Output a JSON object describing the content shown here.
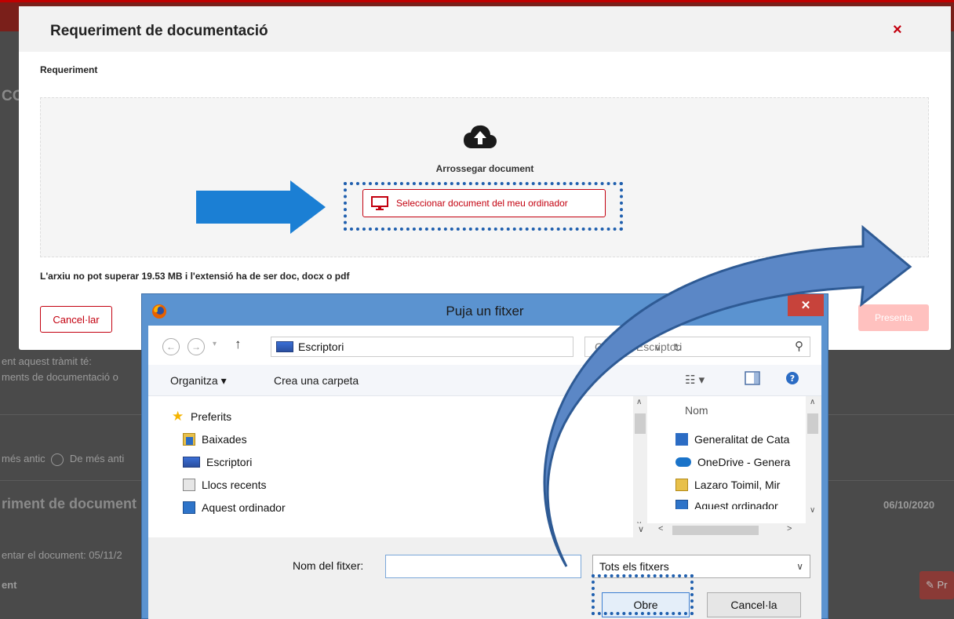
{
  "background": {
    "text_1": "ent aquest tràmit té:",
    "text_2": "ments de documentació o",
    "radio_text_1": "més antic",
    "radio_text_2": "De més anti",
    "item_title": "riment de document",
    "item_date": "06/10/2020",
    "deadline_text": "entar el document: 05/11/2",
    "doc_text": "ent",
    "side_button": "Pr",
    "left_fragment": "CO"
  },
  "modal": {
    "title": "Requeriment de documentació",
    "close": "×",
    "section_label": "Requeriment",
    "drag_label": "Arrossegar document",
    "select_button": "Seleccionar document del meu ordinador",
    "limit_text": "L'arxiu no pot superar 19.53 MB i l'extensió ha de ser doc, docx o pdf",
    "cancel_button": "Cancel·lar",
    "present_button": "Presenta"
  },
  "dialog": {
    "title": "Puja un fitxer",
    "close": "✕",
    "address": "Escriptori",
    "search_placeholder": "Cerca a Escriptori",
    "organize": "Organitza ▾",
    "new_folder": "Crea una carpeta",
    "tree": [
      {
        "label": "Preferits"
      },
      {
        "label": "Baixades"
      },
      {
        "label": "Escriptori"
      },
      {
        "label": "Llocs recents"
      },
      {
        "label": "Aquest ordinador"
      }
    ],
    "column_name": "Nom",
    "files": [
      {
        "label": "Generalitat de Cata"
      },
      {
        "label": "OneDrive - Genera"
      },
      {
        "label": "Lazaro Toimil, Mir"
      },
      {
        "label": "Aquest ordinador"
      }
    ],
    "filename_label": "Nom del fitxer:",
    "filename_value": "",
    "filetype": "Tots els fitxers",
    "open_button": "Obre",
    "cancel_button": "Cancel·la"
  },
  "colors": {
    "accent_red": "#c3000f",
    "dialog_blue": "#5b93d0",
    "highlight_blue": "#1f5fae"
  }
}
